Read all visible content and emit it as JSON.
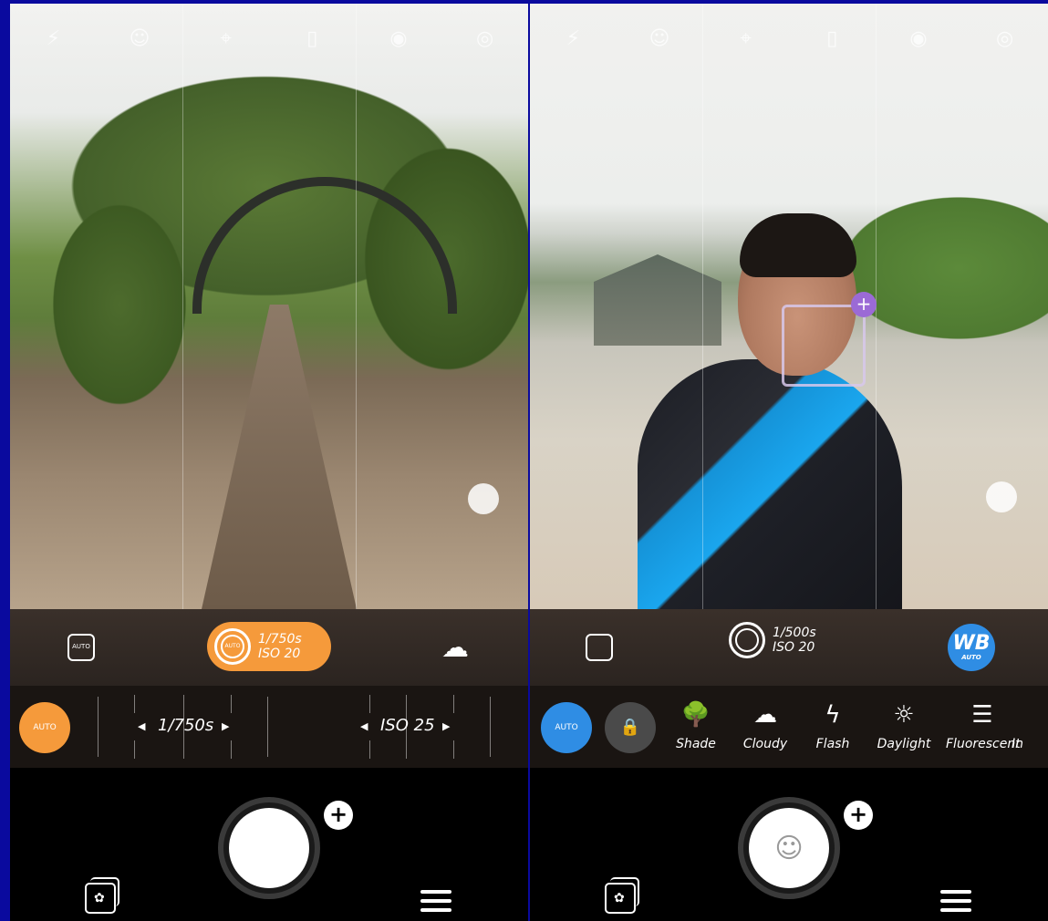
{
  "left_screen": {
    "shutter_mode_value": "1/750s",
    "iso_mode_value": "ISO 20",
    "focus_mode_label": "AUTO",
    "aperture_label": "AUTO",
    "auto_button_label": "AUTO",
    "shutter_dial_value": "1/750s",
    "iso_dial_value": "ISO 25",
    "exposure_level": 0.5
  },
  "right_screen": {
    "shutter_mode_value": "1/500s",
    "iso_mode_value": "ISO 20",
    "wb_badge_label": "WB",
    "wb_badge_sub": "AUTO",
    "auto_button_label": "AUTO",
    "white_balance_presets": [
      {
        "label": "Shade",
        "icon": "shade-tree-icon"
      },
      {
        "label": "Cloudy",
        "icon": "cloud-icon"
      },
      {
        "label": "Flash",
        "icon": "flash-icon"
      },
      {
        "label": "Daylight",
        "icon": "sun-icon"
      },
      {
        "label": "Fluorescent",
        "icon": "fluorescent-bulb-icon"
      },
      {
        "label": "In",
        "icon": "incandescent-icon"
      }
    ],
    "focus_plus_label": "+"
  },
  "bottom": {
    "plus_label": "+"
  },
  "colors": {
    "accent_orange": "#f59a3b",
    "accent_blue": "#2f8de4",
    "background_border": "#0a0a9e"
  }
}
